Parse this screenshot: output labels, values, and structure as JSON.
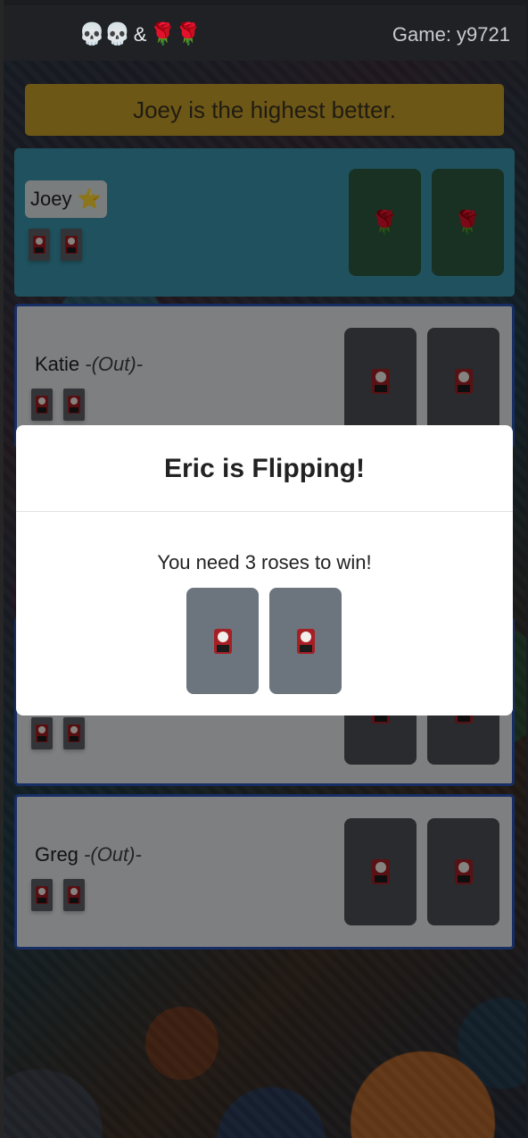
{
  "navbar": {
    "brand_left": "💀💀",
    "brand_amp": "&",
    "brand_right": "🌹🌹",
    "game_label": "Game: y9721"
  },
  "banner": {
    "text": "Joey is the highest better."
  },
  "players": {
    "joey": {
      "name": "Joey",
      "badge_icon": "⭐",
      "cards_played": [
        "rose",
        "rose"
      ],
      "hand_count": 2
    },
    "katie": {
      "name": "Katie",
      "status": "-(Out)-",
      "hand_count": 2,
      "cards_played": 2
    },
    "eric": {
      "hand_count": 2,
      "cards_played": 2
    },
    "greg": {
      "name": "Greg",
      "status": "-(Out)-",
      "hand_count": 2,
      "cards_played": 2
    }
  },
  "modal": {
    "title": "Eric is Flipping!",
    "message": "You need 3 roses to win!",
    "cards": [
      "skull-coaster-icon",
      "skull-coaster-icon"
    ]
  },
  "colors": {
    "banner": "#c79e2a",
    "active_player": "#3a95ab",
    "player_border": "#2a54b8",
    "rose_card": "#2c5a3e",
    "facedown_card": "#4b4f55"
  }
}
